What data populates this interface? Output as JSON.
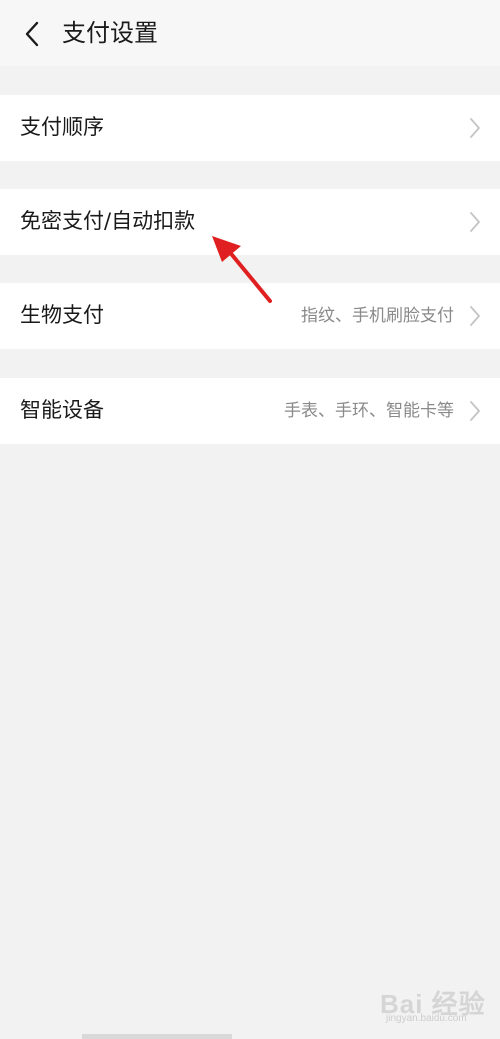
{
  "header": {
    "title": "支付设置"
  },
  "settings": [
    {
      "label": "支付顺序",
      "value": ""
    },
    {
      "label": "免密支付/自动扣款",
      "value": ""
    },
    {
      "label": "生物支付",
      "value": "指纹、手机刷脸支付"
    },
    {
      "label": "智能设备",
      "value": "手表、手环、智能卡等"
    }
  ],
  "watermark": {
    "brand": "Bai 经验",
    "url": "jingyan.baidu.com"
  },
  "colors": {
    "annotation_arrow": "#e02020",
    "background": "#f2f2f2",
    "row_background": "#ffffff",
    "secondary_text": "#8a8a8a"
  },
  "icons": {
    "back": "chevron-left-icon",
    "row_disclosure": "chevron-right-icon"
  }
}
